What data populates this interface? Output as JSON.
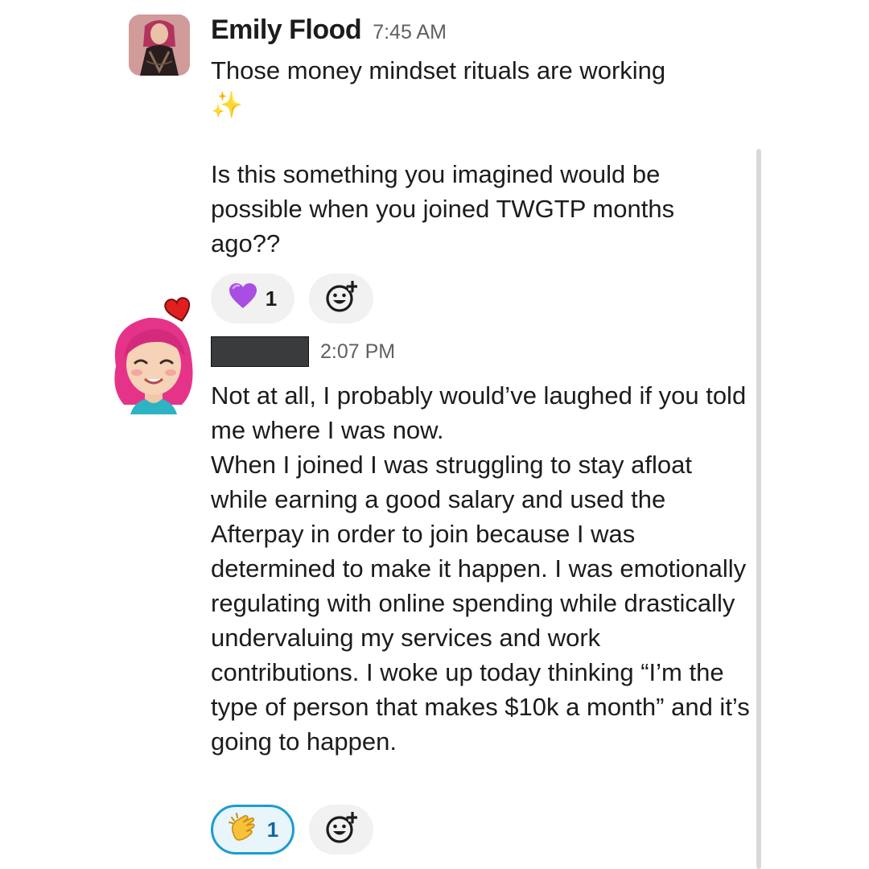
{
  "messages": [
    {
      "sender": "Emily Flood",
      "time": "7:45 AM",
      "paragraphs": [
        "Those money mindset rituals are working",
        "Is this something you imagined would be possible when you joined TWGTP months ago??"
      ],
      "sparkles": "✨",
      "reactions": [
        {
          "emoji": "purple-heart",
          "count": "1"
        }
      ]
    },
    {
      "sender": "",
      "time": "2:07 PM",
      "paragraphs": [
        "Not at all, I probably would’ve laughed if you told me where I was now.",
        "When I joined I was struggling to stay afloat while earning a good salary and used the Afterpay in order to join because I was determined to make it happen. I was emotionally regulating with online spending while drastically undervaluing my services and work contributions. I woke up today thinking “I’m the type of person that makes $10k a month” and it’s going to happen."
      ],
      "reactions": [
        {
          "emoji": "clapping-hands",
          "count": "1"
        }
      ]
    }
  ],
  "colors": {
    "text": "#1d1c1d",
    "timestamp": "#616061",
    "reaction_bg": "#f1f1f1",
    "active_border": "#1d9bd1",
    "active_bg": "#e8f5fa"
  }
}
